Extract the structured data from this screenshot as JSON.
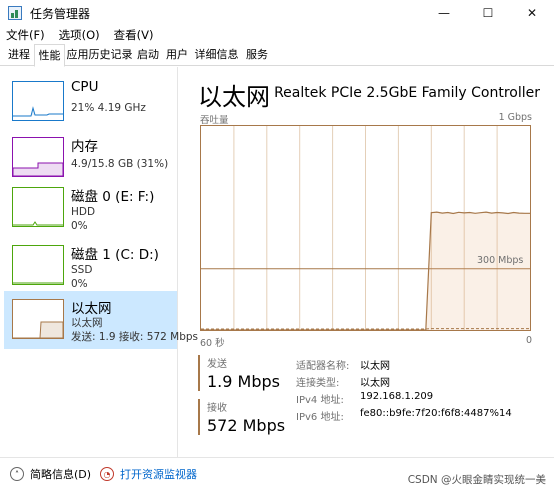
{
  "window": {
    "title": "任务管理器",
    "controls": {
      "minimize": "—",
      "maximize": "☐",
      "close": "✕"
    }
  },
  "menu": [
    "文件(F)",
    "选项(O)",
    "查看(V)"
  ],
  "tabs": [
    "进程",
    "性能",
    "应用历史记录",
    "启动",
    "用户",
    "详细信息",
    "服务"
  ],
  "active_tab": "性能",
  "resources": [
    {
      "name": "CPU",
      "sub1": "21% 4.19 GHz",
      "sub2": "",
      "color": "#1979ca"
    },
    {
      "name": "内存",
      "sub1": "4.9/15.8 GB (31%)",
      "sub2": "",
      "color": "#8b12ae"
    },
    {
      "name": "磁盘 0 (E: F:)",
      "sub1": "HDD",
      "sub2": "0%",
      "color": "#4da60c"
    },
    {
      "name": "磁盘 1 (C: D:)",
      "sub1": "SSD",
      "sub2": "0%",
      "color": "#4da60c"
    },
    {
      "name": "以太网",
      "sub1": "以太网",
      "sub2": "发送: 1.9  接收: 572 Mbps",
      "color": "#a7784a"
    }
  ],
  "detail": {
    "title": "以太网",
    "adapter": "Realtek PCIe 2.5GbE Family Controller",
    "throughput_label": "吞吐量",
    "max_label": "1 Gbps",
    "mid_label": "300 Mbps",
    "time_left": "60 秒",
    "time_right": "0",
    "send_label": "发送",
    "send_value": "1.9 Mbps",
    "recv_label": "接收",
    "recv_value": "572 Mbps",
    "info": [
      {
        "key": "适配器名称:",
        "value": "以太网"
      },
      {
        "key": "连接类型:",
        "value": "以太网"
      },
      {
        "key": "IPv4 地址:",
        "value": "192.168.1.209"
      },
      {
        "key": "IPv6 地址:",
        "value": "fe80::b9fe:7f20:f6f8:4487%14"
      }
    ]
  },
  "graph_series": {
    "receive_mbps": [
      0,
      0,
      0,
      0,
      0,
      0,
      0,
      0,
      0,
      0,
      0,
      0,
      0,
      0,
      0,
      0,
      0,
      0,
      0,
      0,
      0,
      0,
      0,
      0,
      0,
      0,
      0,
      0,
      0,
      0,
      0,
      0,
      0,
      0,
      0,
      0,
      0,
      0,
      0,
      0,
      0,
      0,
      575,
      578,
      573,
      576,
      571,
      577,
      574,
      576,
      572,
      575,
      578,
      573,
      576,
      574,
      571,
      576,
      573,
      572,
      572
    ],
    "send_mbps": [
      0,
      0,
      0,
      0,
      0,
      0,
      0,
      0,
      0,
      0,
      0,
      0,
      0,
      0,
      0,
      0,
      0,
      0,
      0,
      0,
      0,
      0,
      0,
      0,
      0,
      0,
      0,
      0,
      0,
      0,
      0,
      0,
      0,
      0,
      0,
      0,
      0,
      0,
      0,
      0,
      0,
      0,
      2,
      2,
      2,
      2,
      2,
      2,
      2,
      2,
      2,
      2,
      2,
      2,
      2,
      2,
      2,
      2,
      2,
      2,
      2
    ],
    "max_mbps": 1000
  },
  "footer": {
    "brief": "简略信息(D)",
    "monitor": "打开资源监视器",
    "watermark": "CSDN @火眼金睛实现统一美"
  }
}
